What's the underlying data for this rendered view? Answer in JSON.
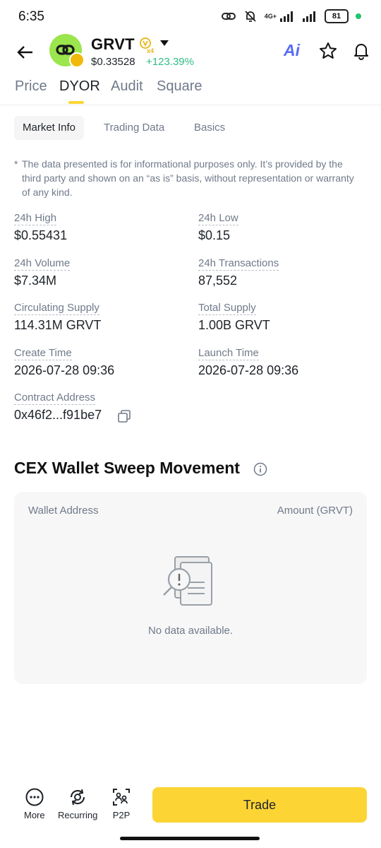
{
  "status_bar": {
    "time": "6:35",
    "network": "4G+",
    "battery": "81"
  },
  "header": {
    "coin_name": "GRVT",
    "multiplier": "x4",
    "price": "$0.33528",
    "change": "+123.39%",
    "ai_label": "Ai"
  },
  "main_tabs": [
    {
      "label": "Price"
    },
    {
      "label": "DYOR"
    },
    {
      "label": "Audit"
    },
    {
      "label": "Square"
    }
  ],
  "sub_tabs": [
    {
      "label": "Market Info"
    },
    {
      "label": "Trading Data"
    },
    {
      "label": "Basics"
    }
  ],
  "disclaimer": {
    "asterisk": "*",
    "text": "The data presented is for informational purposes only. It’s provided by the third party and shown on an “as is” basis, without representation or warranty of any kind."
  },
  "stats": {
    "high_24h": {
      "label": "24h High",
      "value": "$0.55431"
    },
    "low_24h": {
      "label": "24h Low",
      "value": "$0.15"
    },
    "volume_24h": {
      "label": "24h Volume",
      "value": "$7.34M"
    },
    "transactions_24h": {
      "label": "24h Transactions",
      "value": "87,552"
    },
    "circulating_supply": {
      "label": "Circulating Supply",
      "value": "114.31M GRVT"
    },
    "total_supply": {
      "label": "Total Supply",
      "value": "1.00B GRVT"
    },
    "create_time": {
      "label": "Create Time",
      "value": "2026-07-28 09:36"
    },
    "launch_time": {
      "label": "Launch Time",
      "value": "2026-07-28 09:36"
    },
    "contract_address": {
      "label": "Contract Address",
      "value": "0x46f2...f91be7"
    }
  },
  "sweep": {
    "title": "CEX Wallet Sweep Movement",
    "col_wallet": "Wallet Address",
    "col_amount": "Amount (GRVT)",
    "empty_text": "No data available."
  },
  "bottom_bar": {
    "more_label": "More",
    "recurring_label": "Recurring",
    "p2p_label": "P2P",
    "trade_label": "Trade"
  },
  "colors": {
    "accent_yellow": "#fcd535",
    "positive_green": "#2ebd85",
    "text_primary": "#1e2329",
    "text_secondary": "#707a8a",
    "ai_blue": "#5a6cf5",
    "coin_logo_green": "#9be54d"
  }
}
